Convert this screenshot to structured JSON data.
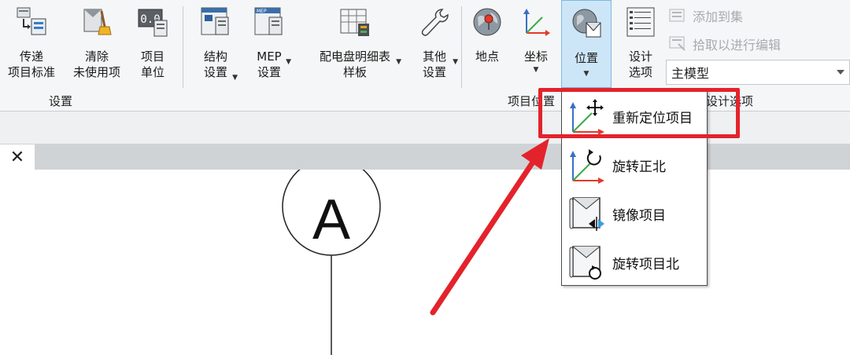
{
  "ribbon": {
    "group_settings_label": "设置",
    "group_location_label": "项目位置",
    "group_design_label": "设计选项",
    "buttons": {
      "transfer": [
        "传递",
        "项目标准"
      ],
      "purge": [
        "清除",
        "未使用项"
      ],
      "units": [
        "项目",
        "单位"
      ],
      "structural": [
        "结构",
        "设置"
      ],
      "mep": [
        "MEP",
        "设置"
      ],
      "panel": [
        "配电盘明细表",
        "样板"
      ],
      "other": [
        "其他",
        "设置"
      ],
      "site": [
        "地点"
      ],
      "coordinates": [
        "坐标"
      ],
      "position": [
        "位置"
      ],
      "design_options": [
        "设计",
        "选项"
      ]
    },
    "add_to_set": "添加到集",
    "pick_to_edit": "拾取以进行编辑",
    "main_model": "主模型"
  },
  "dropdown": {
    "items": [
      "重新定位项目",
      "旋转正北",
      "镜像项目",
      "旋转项目北"
    ]
  },
  "view": {
    "close_glyph": "✕",
    "grid_label": "A"
  },
  "colors": {
    "highlight": "#e3232c",
    "arrow": "#e3232c",
    "active_button": "#cde6f7"
  }
}
